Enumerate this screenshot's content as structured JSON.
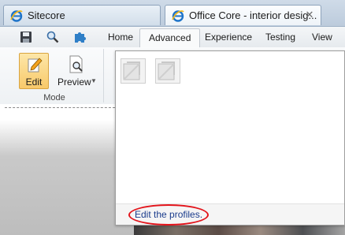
{
  "browser": {
    "tabs": [
      {
        "label": "Sitecore",
        "icon": "ie-icon",
        "active": false
      },
      {
        "label": "Office Core - interior desig...",
        "icon": "ie-icon",
        "active": true
      }
    ],
    "close_glyph": "✕"
  },
  "ribbon": {
    "quick_access": [
      "save-icon",
      "search-icon",
      "puzzle-icon"
    ],
    "tabs": [
      "Home",
      "Advanced",
      "Experience",
      "Testing",
      "View"
    ],
    "active_tab": "Advanced",
    "group": {
      "label": "Mode",
      "buttons": [
        {
          "label": "Edit",
          "icon": "pencil-icon",
          "selected": true
        },
        {
          "label": "Preview",
          "icon": "preview-icon",
          "dropdown": true
        }
      ]
    }
  },
  "popup": {
    "thumbnails": [
      "profile-image-placeholder-icon",
      "profile-image-placeholder-icon"
    ],
    "link_text": "Edit the profiles."
  },
  "colors": {
    "highlight": "#e3141b",
    "link": "#1a3c8c",
    "edit_button_fill": "#f8c96a"
  }
}
